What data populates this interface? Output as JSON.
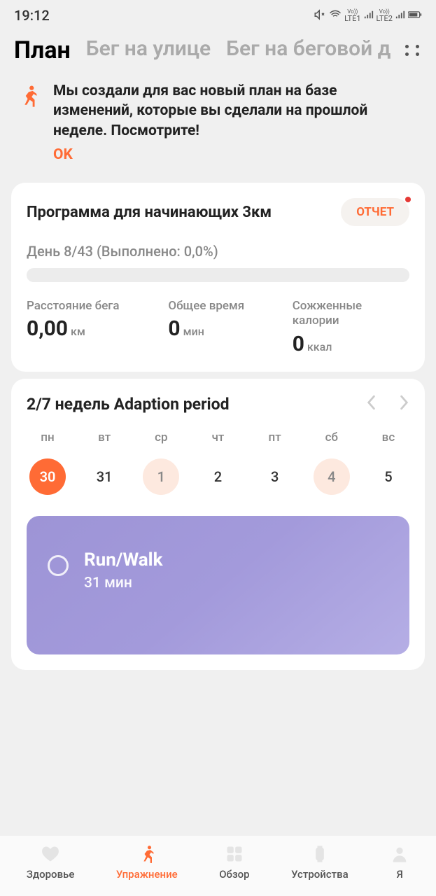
{
  "status": {
    "time": "19:12",
    "net1": "LTE1",
    "net2": "LTE2",
    "vo": "Vo))"
  },
  "tabs": {
    "items": [
      {
        "label": "План"
      },
      {
        "label": "Бег на улице"
      },
      {
        "label": "Бег на беговой д"
      }
    ]
  },
  "notif": {
    "text": "Мы создали для вас новый план на базе изменений, которые вы сделали на прошлой неделе. Посмотрите!",
    "ok": "OK"
  },
  "program": {
    "title": "Программа для начинающих 3км",
    "report": "ОТЧЕТ",
    "progress_label": "День 8/43 (Выполнено: 0,0%)",
    "stats": {
      "distance": {
        "label": "Расстояние бега",
        "value": "0,00",
        "unit": "км"
      },
      "time": {
        "label": "Общее время",
        "value": "0",
        "unit": "мин"
      },
      "calories": {
        "label": "Сожженные калории",
        "value": "0",
        "unit": "ккал"
      }
    }
  },
  "week": {
    "title": "2/7 недель Adaption period",
    "days": [
      {
        "name": "пн",
        "num": "30",
        "state": "active"
      },
      {
        "name": "вт",
        "num": "31",
        "state": ""
      },
      {
        "name": "ср",
        "num": "1",
        "state": "dim-mark"
      },
      {
        "name": "чт",
        "num": "2",
        "state": ""
      },
      {
        "name": "пт",
        "num": "3",
        "state": ""
      },
      {
        "name": "сб",
        "num": "4",
        "state": "dim-mark"
      },
      {
        "name": "вс",
        "num": "5",
        "state": ""
      }
    ],
    "workout": {
      "title": "Run/Walk",
      "sub": "31 мин"
    }
  },
  "nav": {
    "items": [
      {
        "label": "Здоровье"
      },
      {
        "label": "Упражнение"
      },
      {
        "label": "Обзор"
      },
      {
        "label": "Устройства"
      },
      {
        "label": "Я"
      }
    ]
  }
}
